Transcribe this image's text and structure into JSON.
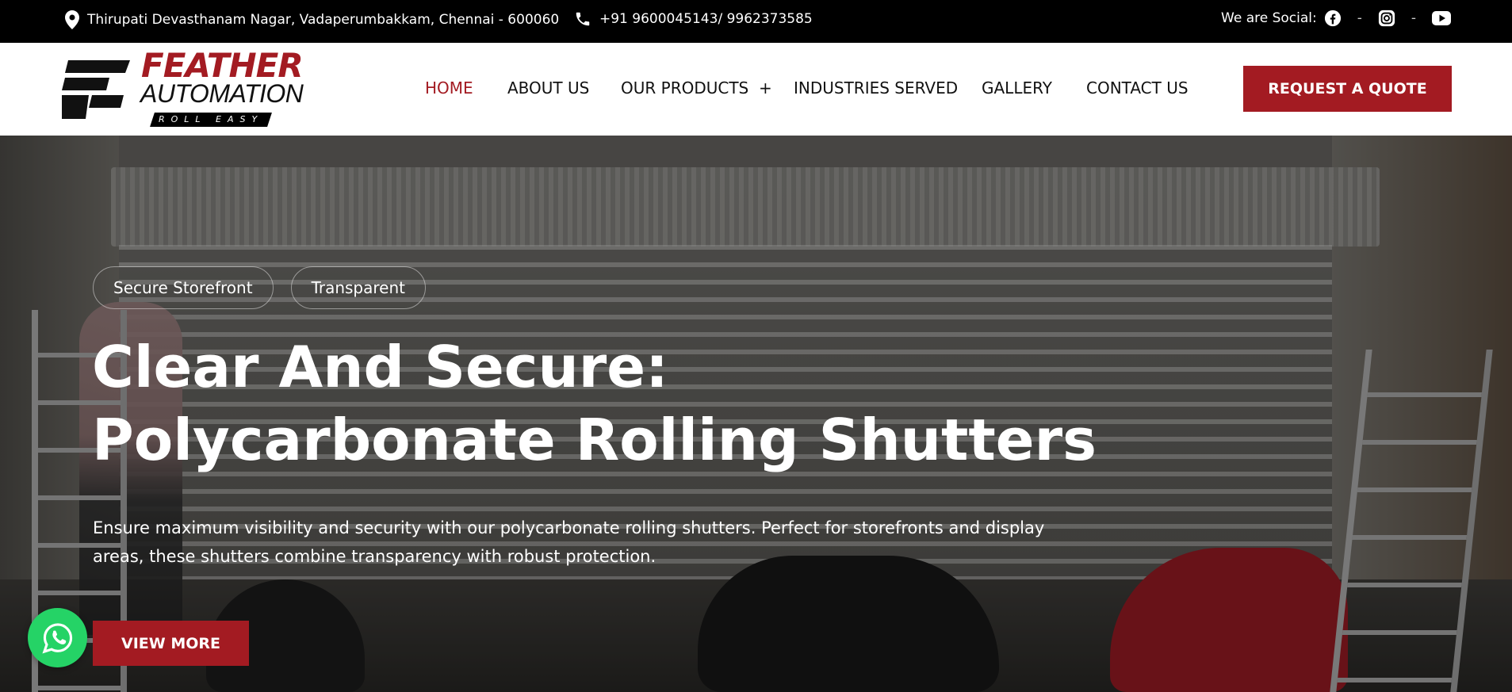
{
  "topbar": {
    "address": "Thirupati Devasthanam Nagar, Vadaperumbakkam, Chennai - 600060",
    "phone": "+91 9600045143/ 9962373585",
    "social_label": "We are Social:",
    "separator": "-",
    "social_icons": [
      "facebook-icon",
      "instagram-icon",
      "youtube-icon"
    ]
  },
  "logo": {
    "line1": "FEATHER",
    "line2": "AUTOMATION",
    "tagline": "ROLL EASY"
  },
  "nav": {
    "items": [
      {
        "label": "HOME",
        "active": true
      },
      {
        "label": "ABOUT US"
      },
      {
        "label": "OUR PRODUCTS  +"
      },
      {
        "label": "INDUSTRIES SERVED"
      },
      {
        "label": "GALLERY"
      },
      {
        "label": "CONTACT US"
      }
    ],
    "cta": "REQUEST A QUOTE"
  },
  "hero": {
    "tags": [
      "Secure Storefront",
      "Transparent"
    ],
    "title_line1": "Clear And Secure:",
    "title_line2": "Polycarbonate Rolling Shutters",
    "description": "Ensure maximum visibility and security with our polycarbonate rolling shutters. Perfect for storefronts and display areas, these shutters combine transparency with robust protection.",
    "button": "VIEW MORE"
  },
  "colors": {
    "brand": "#a31b22",
    "topbar": "#000000",
    "whatsapp": "#25d366"
  }
}
